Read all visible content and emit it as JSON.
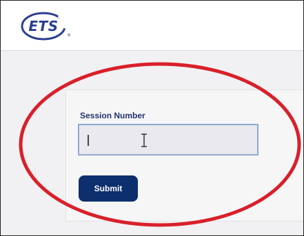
{
  "header": {
    "logo_text": "ETS"
  },
  "form": {
    "session_label": "Session Number",
    "session_value": "",
    "submit_label": "Submit"
  },
  "colors": {
    "brand_navy": "#0d2f6e",
    "logo_blue": "#2b3f8f",
    "input_border": "#8eaad0",
    "annotation_red": "#d9202a"
  },
  "icons": {
    "logo": "ets-logo-icon",
    "cursor": "text-cursor-icon",
    "annotation": "highlight-ellipse"
  }
}
